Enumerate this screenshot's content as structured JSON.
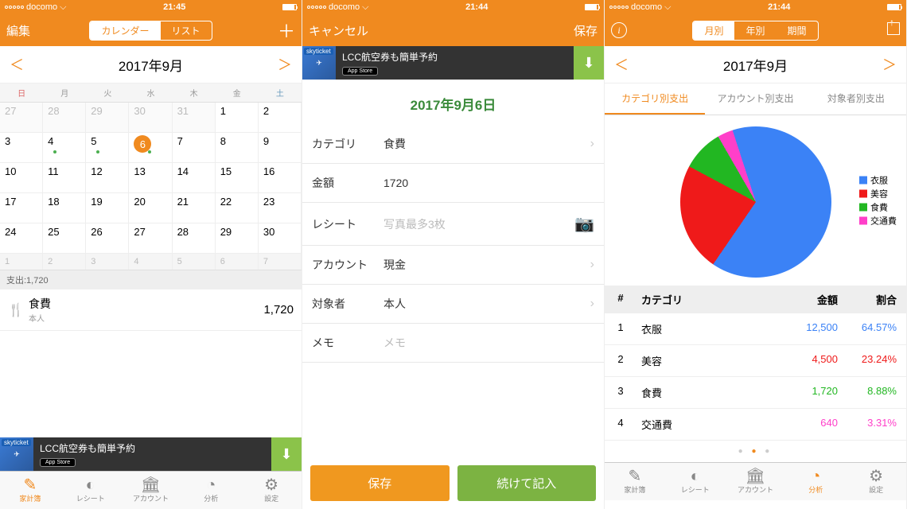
{
  "status": {
    "carrier": "docomo",
    "time1": "21:45",
    "time2": "21:44",
    "time3": "21:44"
  },
  "colors": {
    "orange": "#f08a1f",
    "green": "#7cb342"
  },
  "screen1": {
    "nav": {
      "left": "編集",
      "seg": [
        "カレンダー",
        "リスト"
      ],
      "plus": "＋"
    },
    "month": {
      "title": "2017年9月",
      "prev": "＜",
      "next": "＞"
    },
    "weekdays": [
      "日",
      "月",
      "火",
      "水",
      "木",
      "金",
      "土"
    ],
    "grid": [
      [
        {
          "d": 27,
          "o": true
        },
        {
          "d": 28,
          "o": true
        },
        {
          "d": 29,
          "o": true
        },
        {
          "d": 30,
          "o": true
        },
        {
          "d": 31,
          "o": true
        },
        {
          "d": 1
        },
        {
          "d": 2
        }
      ],
      [
        {
          "d": 3
        },
        {
          "d": 4,
          "dot": true
        },
        {
          "d": 5,
          "dot": true
        },
        {
          "d": 6,
          "sel": true,
          "dot": true
        },
        {
          "d": 7
        },
        {
          "d": 8
        },
        {
          "d": 9
        }
      ],
      [
        {
          "d": 10
        },
        {
          "d": 11
        },
        {
          "d": 12
        },
        {
          "d": 13
        },
        {
          "d": 14
        },
        {
          "d": 15
        },
        {
          "d": 16
        }
      ],
      [
        {
          "d": 17
        },
        {
          "d": 18
        },
        {
          "d": 19
        },
        {
          "d": 20
        },
        {
          "d": 21
        },
        {
          "d": 22
        },
        {
          "d": 23
        }
      ],
      [
        {
          "d": 24
        },
        {
          "d": 25
        },
        {
          "d": 26
        },
        {
          "d": 27
        },
        {
          "d": 28
        },
        {
          "d": 29
        },
        {
          "d": 30
        }
      ]
    ],
    "next_strip": [
      1,
      2,
      3,
      4,
      5,
      6,
      7
    ],
    "summary": "支出:1,720",
    "item": {
      "category": "食費",
      "who": "本人",
      "amount": "1,720"
    },
    "ad": {
      "label": "skyticket",
      "text": "LCC航空券も簡単予約",
      "store": "App Store"
    }
  },
  "screen2": {
    "nav": {
      "cancel": "キャンセル",
      "save": "保存"
    },
    "ad": {
      "label": "skyticket",
      "text": "LCC航空券も簡単予約",
      "store": "App Store"
    },
    "date": "2017年9月6日",
    "rows": {
      "category": {
        "label": "カテゴリ",
        "value": "食費"
      },
      "amount": {
        "label": "金額",
        "value": "1720"
      },
      "receipt": {
        "label": "レシート",
        "placeholder": "写真最多3枚"
      },
      "account": {
        "label": "アカウント",
        "value": "現金"
      },
      "target": {
        "label": "対象者",
        "value": "本人"
      },
      "memo": {
        "label": "メモ",
        "placeholder": "メモ"
      }
    },
    "buttons": {
      "save": "保存",
      "continue": "続けて記入"
    }
  },
  "screen3": {
    "nav": {
      "seg": [
        "月別",
        "年別",
        "期間"
      ]
    },
    "month_title": "2017年9月",
    "tabs": [
      "カテゴリ別支出",
      "アカウント別支出",
      "対象者別支出"
    ],
    "legend": [
      {
        "name": "衣服",
        "color": "#3b82f6"
      },
      {
        "name": "美容",
        "color": "#ef1a1a"
      },
      {
        "name": "食費",
        "color": "#22b722"
      },
      {
        "name": "交通費",
        "color": "#ff3fc9"
      }
    ],
    "table": {
      "headers": [
        "#",
        "カテゴリ",
        "金額",
        "割合"
      ],
      "rows": [
        {
          "n": 1,
          "cat": "衣服",
          "amt": "12,500",
          "pct": "64.57%",
          "color": "#3b82f6"
        },
        {
          "n": 2,
          "cat": "美容",
          "amt": "4,500",
          "pct": "23.24%",
          "color": "#ef1a1a"
        },
        {
          "n": 3,
          "cat": "食費",
          "amt": "1,720",
          "pct": "8.88%",
          "color": "#22b722"
        },
        {
          "n": 4,
          "cat": "交通費",
          "amt": "640",
          "pct": "3.31%",
          "color": "#ff3fc9"
        }
      ]
    }
  },
  "tabs": [
    {
      "label": "家計簿",
      "icon": "✎"
    },
    {
      "label": "レシート",
      "icon": "◐"
    },
    {
      "label": "アカウント",
      "icon": "🏛"
    },
    {
      "label": "分析",
      "icon": "◔"
    },
    {
      "label": "設定",
      "icon": "⚙"
    }
  ],
  "chart_data": {
    "type": "pie",
    "title": "カテゴリ別支出 2017年9月",
    "series": [
      {
        "name": "衣服",
        "value": 12500,
        "pct": 64.57,
        "color": "#3b82f6"
      },
      {
        "name": "美容",
        "value": 4500,
        "pct": 23.24,
        "color": "#ef1a1a"
      },
      {
        "name": "食費",
        "value": 1720,
        "pct": 8.88,
        "color": "#22b722"
      },
      {
        "name": "交通費",
        "value": 640,
        "pct": 3.31,
        "color": "#ff3fc9"
      }
    ]
  }
}
